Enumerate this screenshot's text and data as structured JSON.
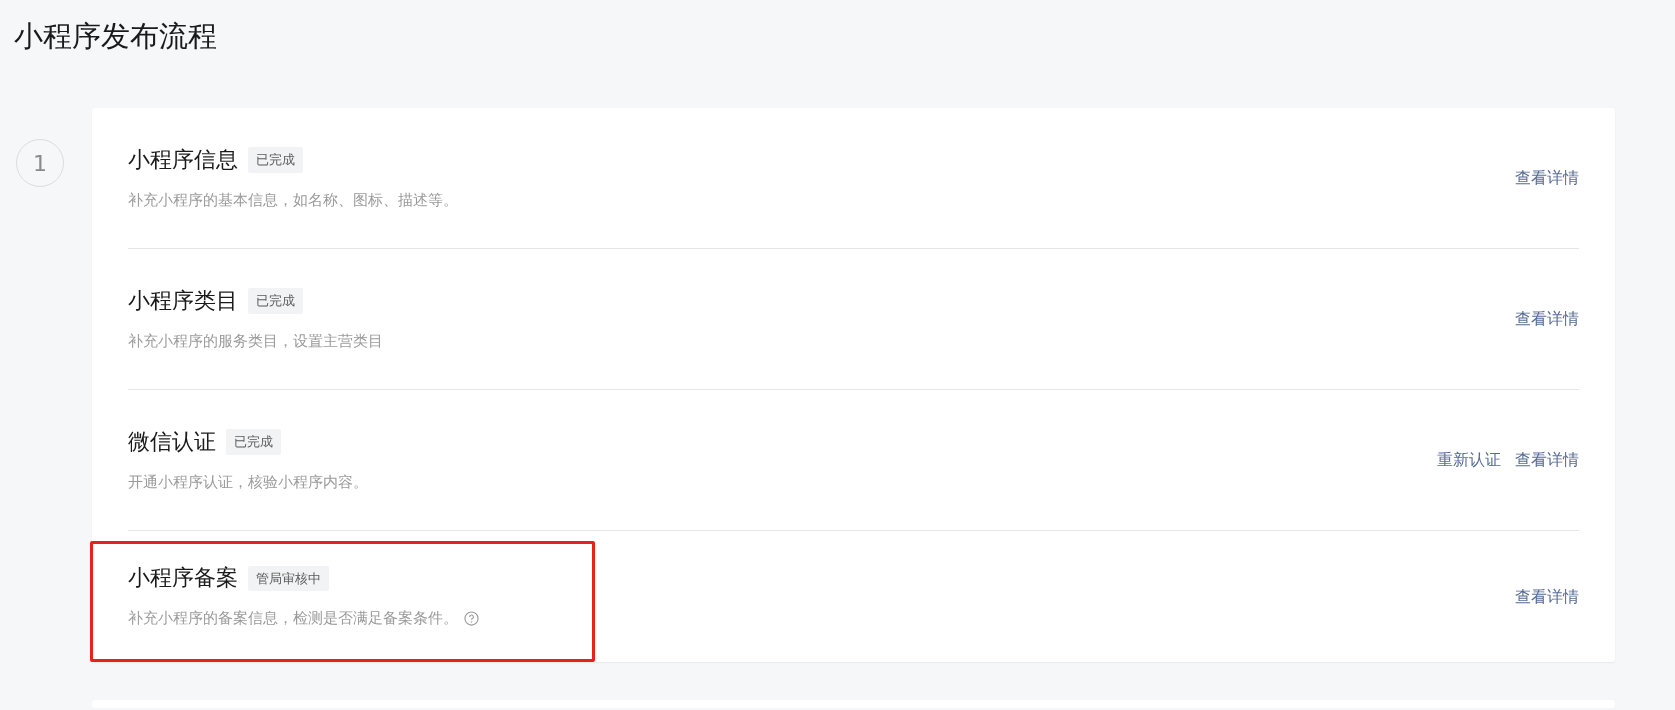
{
  "page_title": "小程序发布流程",
  "steps": [
    {
      "number": "1",
      "items": [
        {
          "title": "小程序信息",
          "status": "已完成",
          "description": "补充小程序的基本信息，如名称、图标、描述等。",
          "actions": [
            "查看详情"
          ]
        },
        {
          "title": "小程序类目",
          "status": "已完成",
          "description": "补充小程序的服务类目，设置主营类目",
          "actions": [
            "查看详情"
          ]
        },
        {
          "title": "微信认证",
          "status": "已完成",
          "description": "开通小程序认证，核验小程序内容。",
          "actions": [
            "重新认证",
            "查看详情"
          ]
        },
        {
          "title": "小程序备案",
          "status": "管局审核中",
          "description": "补充小程序的备案信息，检测是否满足备案条件。",
          "help": true,
          "highlighted": true,
          "actions": [
            "查看详情"
          ]
        }
      ]
    }
  ]
}
